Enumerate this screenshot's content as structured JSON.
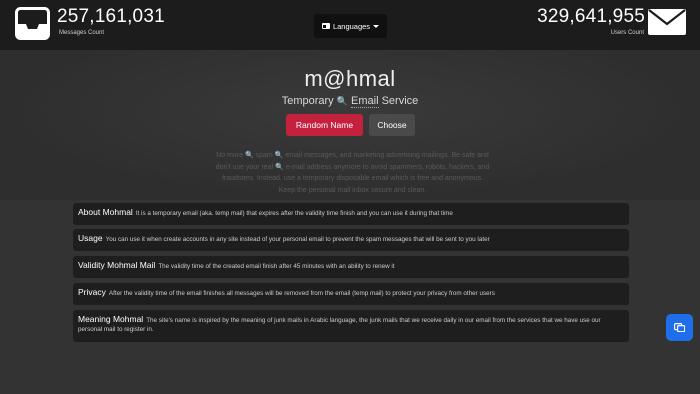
{
  "header": {
    "messages_count": "257,161,031",
    "messages_label": "Messages Count",
    "users_count": "329,641,955",
    "users_label": "Users Count",
    "languages_label": "Languages",
    "icons": [
      "inbox-tray-icon",
      "envelope-icon",
      "flag-icon",
      "caret-down-icon"
    ]
  },
  "hero": {
    "logo_text": "m@hmal",
    "tagline_prefix": "Temporary ",
    "tagline_icon": "🔍",
    "tagline_email": "Email",
    "tagline_suffix": " Service",
    "random_button": "Random Name",
    "choose_button": "Choose",
    "description": "No more 🔍 spam 🔍 email messages, and marketing advertising mailings. Be safe and don't use your real 🔍 e-mail address anymore to avoid spammers, robots, hackers, and fraudsters. Instead, use a temporary disposable email which is free and anonymous. Keep the personal mail inbox secure and clean."
  },
  "info": [
    {
      "title": "About Mohmal",
      "text": "It is a temporary email (aka. temp mail) that expires after the validity time finish and you can use it during that time"
    },
    {
      "title": "Usage",
      "text": "You can use it when create accounts in any site instead of your personal email to prevent the spam messages that will be sent to you later"
    },
    {
      "title": "Validity Mohmal Mail",
      "text": "The validity time of the created email finish after 45 minutes with an ability to renew it"
    },
    {
      "title": "Privacy",
      "text": "After the validity time of the email finishes all messages will be removed from the email (temp mail) to protect your privacy from other users"
    },
    {
      "title": "Meaning Mohmal",
      "text": "The site's name is inspired by the meaning of junk mails in Arabic language, the junk mails that we receive daily in our email from the services that we have use our personal mail to register in."
    }
  ],
  "colors": {
    "background": "#333333",
    "topbar": "#1c1c1c",
    "accent_red": "#c4213f",
    "fab_blue": "#1f6feb"
  }
}
